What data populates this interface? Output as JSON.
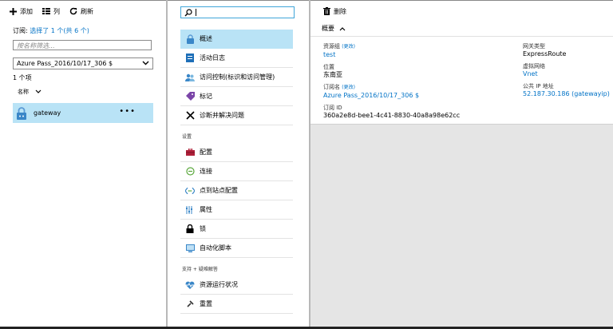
{
  "list_panel": {
    "toolbar": {
      "add": "添加",
      "columns": "列",
      "refresh": "刷新"
    },
    "subscription_prefix": "订阅: ",
    "subscription_link": "选择了 1 个(共 6 个)",
    "filter_placeholder": "按名称筛选...",
    "subscription_select": "Azure Pass_2016/10/17_306 $",
    "count": "1 个项",
    "sort_label": "名称",
    "resource": {
      "name": "gateway",
      "more": "•••"
    }
  },
  "menu_panel": {
    "search_value": "",
    "items_top": [
      "概述",
      "活动日志",
      "访问控制(标识和访问管理)",
      "标记",
      "诊断并解决问题"
    ],
    "section_settings": "设置",
    "items_settings": [
      "配置",
      "连接",
      "点到站点配置",
      "属性",
      "锁",
      "自动化脚本"
    ],
    "section_support": "支持 + 疑难解答",
    "items_support": [
      "资源运行状况",
      "重置"
    ]
  },
  "detail_panel": {
    "toolbar": {
      "delete": "删除"
    },
    "essentials_label": "概要",
    "left": {
      "resource_group_label": "资源组",
      "resource_group_edit": "(更改)",
      "resource_group": "test",
      "location_label": "位置",
      "location": "东南亚",
      "subscription_label": "订阅名",
      "subscription_edit": "(更改)",
      "subscription": "Azure Pass_2016/10/17_306 $",
      "subscription_id_label": "订阅 ID",
      "subscription_id": "360a2e8d-bee1-4c41-8830-40a8a98e62cc"
    },
    "right": {
      "gateway_type_label": "网关类型",
      "gateway_type": "ExpressRoute",
      "vnet_label": "虚拟网络",
      "vnet": "Vnet",
      "public_ip_label": "公共 IP 地址",
      "public_ip": "52.187.30.186 (gatewayip)"
    }
  },
  "colors": {
    "accent": "#0072c6",
    "selected": "#b9e3f6",
    "content_bg": "#e5e5e5"
  }
}
